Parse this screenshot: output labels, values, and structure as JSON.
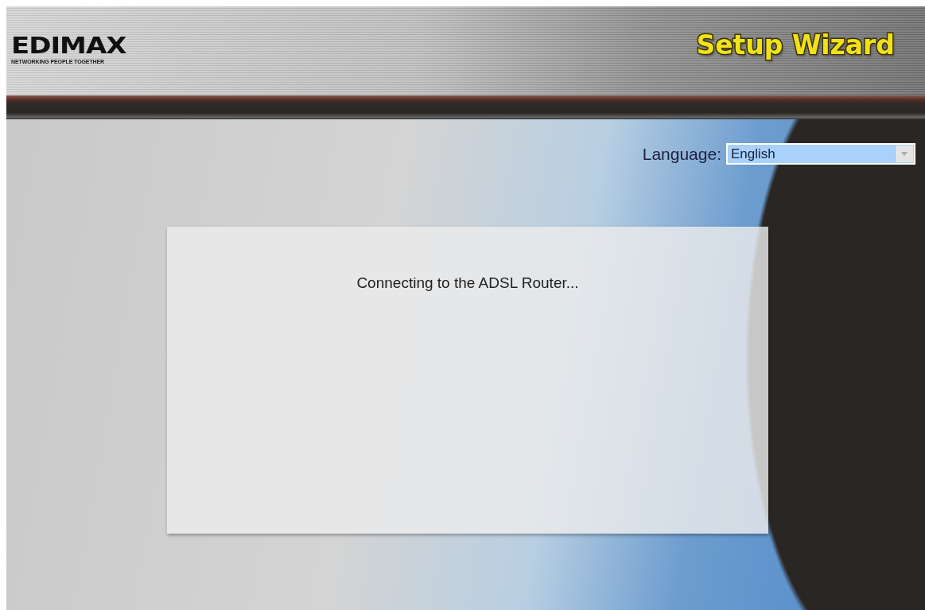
{
  "header": {
    "logo": "EDIMAX",
    "tagline": "NETWORKING PEOPLE TOGETHER",
    "title": "Setup Wizard"
  },
  "language": {
    "label": "Language:",
    "value": "English"
  },
  "panel": {
    "message": "Connecting to the ADSL Router..."
  }
}
